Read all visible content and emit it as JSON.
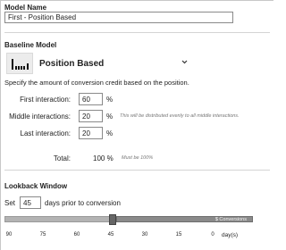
{
  "model_name": {
    "label": "Model Name",
    "value": "First - Position Based"
  },
  "baseline": {
    "label": "Baseline Model",
    "model_icon": "position-based-bars-icon",
    "selected_model": "Position Based",
    "description": "Specify the amount of conversion credit based on the position."
  },
  "interactions": {
    "first": {
      "label": "First interaction:",
      "value": "60",
      "unit": "%"
    },
    "middle": {
      "label": "Middle interactions:",
      "value": "20",
      "unit": "%",
      "note": "This will be distributed evenly to all middle interactions."
    },
    "last": {
      "label": "Last interaction:",
      "value": "20",
      "unit": "%"
    },
    "total": {
      "label": "Total:",
      "value": "100 %",
      "note": "Must be 100%"
    }
  },
  "lookback": {
    "label": "Lookback Window",
    "set_label": "Set",
    "days_value": "45",
    "suffix": "days prior to conversion",
    "conversions_label": "$ Conversions",
    "slider_value_days": 45,
    "slider_max_days": 90,
    "axis_ticks": [
      "90",
      "75",
      "60",
      "45",
      "30",
      "15",
      "0"
    ],
    "axis_unit": "day(s)"
  }
}
